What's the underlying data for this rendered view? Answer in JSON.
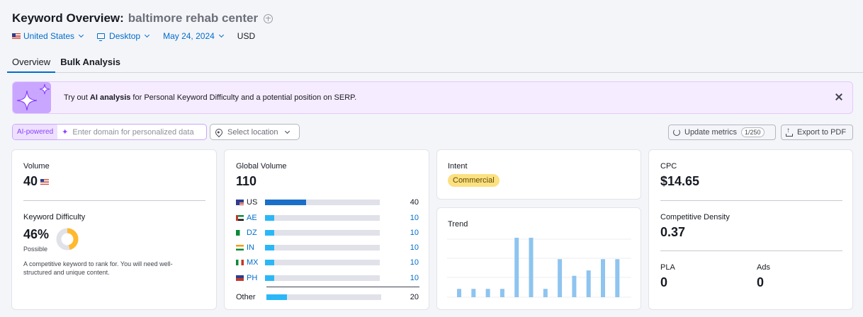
{
  "header": {
    "title": "Keyword Overview:",
    "keyword": "baltimore rehab center",
    "filters": {
      "country": "United States",
      "device": "Desktop",
      "date": "May 24, 2024",
      "currency": "USD"
    }
  },
  "tabs": [
    {
      "label": "Overview",
      "active": true
    },
    {
      "label": "Bulk Analysis",
      "active": false
    }
  ],
  "banner": {
    "prefix": "Try out ",
    "highlight": "AI analysis",
    "suffix": " for Personal Keyword Difficulty and a potential position on SERP."
  },
  "controls": {
    "ai_badge": "AI-powered",
    "domain_placeholder": "Enter domain for personalized data",
    "location_placeholder": "Select location",
    "update_label": "Update metrics",
    "update_counter": "1/250",
    "export_label": "Export to PDF"
  },
  "volume_card": {
    "volume_label": "Volume",
    "volume_value": "40",
    "kd_label": "Keyword Difficulty",
    "kd_value": "46%",
    "kd_percent": 46,
    "kd_status": "Possible",
    "kd_description_1": "A competitive keyword to rank for. You will need well-",
    "kd_description_2": "structured and unique content."
  },
  "global_volume_card": {
    "label": "Global Volume",
    "value": "110",
    "rows": [
      {
        "code": "US",
        "value": "40",
        "share": 0.36
      },
      {
        "code": "AE",
        "value": "10",
        "share": 0.08
      },
      {
        "code": "DZ",
        "value": "10",
        "share": 0.08
      },
      {
        "code": "IN",
        "value": "10",
        "share": 0.08
      },
      {
        "code": "MX",
        "value": "10",
        "share": 0.08
      },
      {
        "code": "PH",
        "value": "10",
        "share": 0.08
      }
    ],
    "other": {
      "code": "Other",
      "value": "20",
      "share": 0.18
    }
  },
  "intent_card": {
    "label": "Intent",
    "badge": "Commercial",
    "badge_color": "#fce081"
  },
  "trend_card": {
    "label": "Trend",
    "values": [
      0.14,
      0.14,
      0.14,
      0.14,
      1.0,
      1.0,
      0.14,
      0.64,
      0.36,
      0.45,
      0.64,
      0.64
    ],
    "bar_color": "#8ec4ef"
  },
  "cpc_card": {
    "cpc_label": "CPC",
    "cpc_value": "$14.65",
    "density_label": "Competitive Density",
    "density_value": "0.37",
    "pla_label": "PLA",
    "pla_value": "0",
    "ads_label": "Ads",
    "ads_value": "0"
  }
}
